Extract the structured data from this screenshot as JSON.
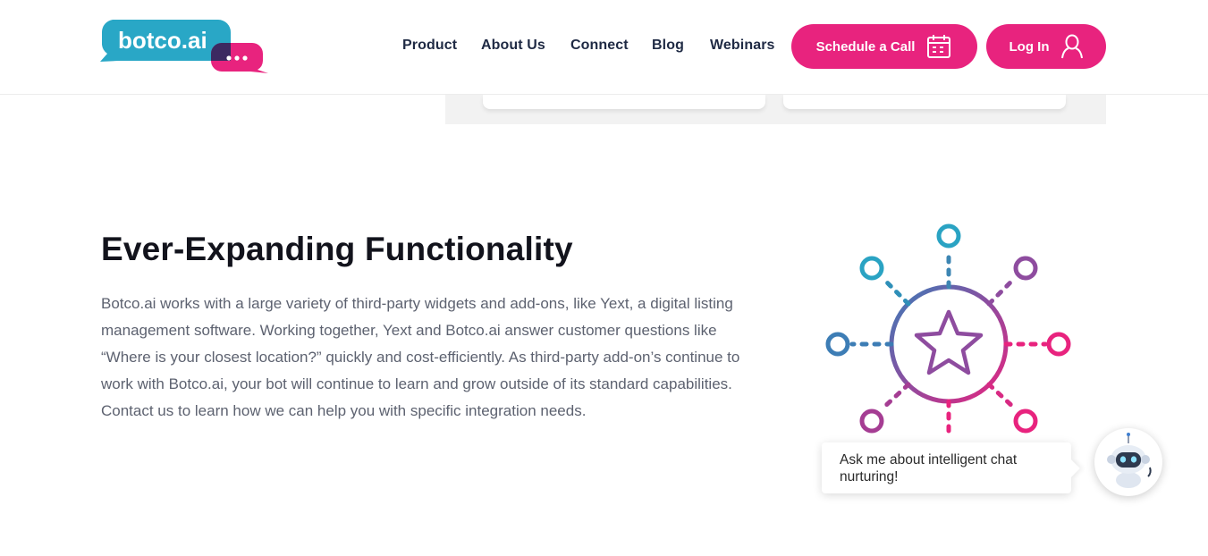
{
  "brand": {
    "logo_text": "botco.ai",
    "colors": {
      "teal": "#29a7c6",
      "pink": "#e8237e",
      "purple": "#8e4c9f"
    }
  },
  "nav": {
    "items": [
      {
        "label": "Product"
      },
      {
        "label": "About Us"
      },
      {
        "label": "Connect"
      },
      {
        "label": "Blog"
      },
      {
        "label": "Webinars"
      }
    ],
    "schedule_button": {
      "label": "Schedule a Call",
      "icon": "calendar-icon"
    },
    "login_button": {
      "label": "Log In",
      "icon": "user-icon"
    }
  },
  "section": {
    "title": "Ever-Expanding Functionality",
    "body": "Botco.ai works with a large variety of third-party widgets and add-ons, like Yext, a digital listing management software. Working together, Yext and Botco.ai answer customer questions like “Where is your closest location?” quickly and cost-efficiently. As third-party add-on’s continue to work with Botco.ai, your bot will continue to learn and grow outside of its standard capabilities. Contact us to learn how we can help you with specific integration needs.",
    "illustration_icon": "star-network-icon"
  },
  "chat_widget": {
    "message": "Ask me about intelligent chat nurturing!",
    "avatar_icon": "robot-icon"
  }
}
